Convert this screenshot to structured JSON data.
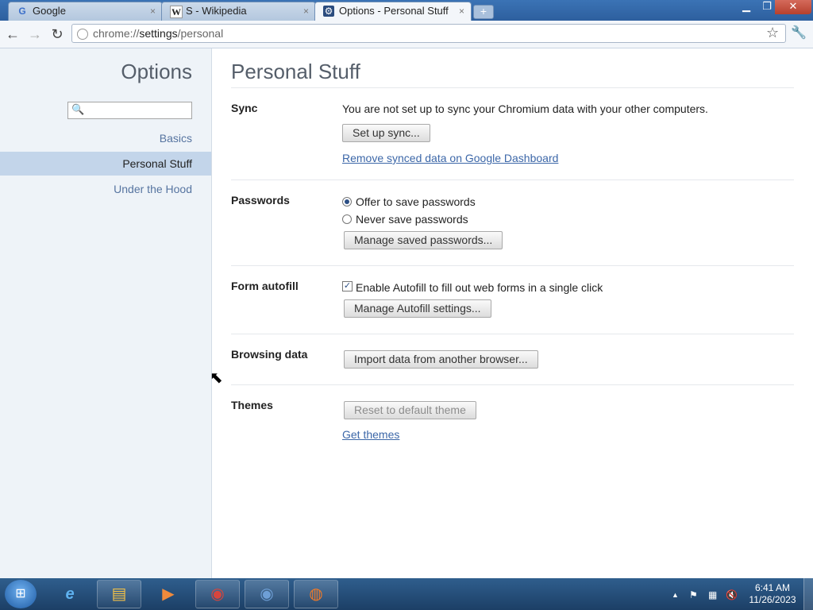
{
  "tabs": [
    {
      "favicon": "G",
      "title": "Google",
      "close": "×"
    },
    {
      "favicon": "W",
      "title": "S - Wikipedia",
      "close": "×"
    },
    {
      "favicon": "⚙",
      "title": "Options - Personal Stuff",
      "close": "×"
    }
  ],
  "new_tab_label": "+",
  "window_controls": {
    "minimize": "▁",
    "maximize": "❐",
    "close": "✕"
  },
  "toolbar": {
    "back": "←",
    "forward": "→",
    "reload": "↻",
    "url_prefix": "chrome://",
    "url_host": "settings",
    "url_path": "/personal",
    "star": "☆",
    "wrench": "🔧"
  },
  "sidebar": {
    "title": "Options",
    "search_icon": "🔍",
    "search_placeholder": "",
    "items": [
      {
        "label": "Basics"
      },
      {
        "label": "Personal Stuff"
      },
      {
        "label": "Under the Hood"
      }
    ]
  },
  "page": {
    "title": "Personal Stuff",
    "sync": {
      "label": "Sync",
      "status": "You are not set up to sync your Chromium data with your other computers.",
      "setup_button": "Set up sync...",
      "dashboard_link": "Remove synced data on Google Dashboard"
    },
    "passwords": {
      "label": "Passwords",
      "offer": "Offer to save passwords",
      "never": "Never save passwords",
      "selected": "offer",
      "manage_button": "Manage saved passwords..."
    },
    "autofill": {
      "label": "Form autofill",
      "checkbox_label": "Enable Autofill to fill out web forms in a single click",
      "checked": true,
      "check_glyph": "✓",
      "manage_button": "Manage Autofill settings..."
    },
    "browsing": {
      "label": "Browsing data",
      "import_button": "Import data from another browser..."
    },
    "themes": {
      "label": "Themes",
      "reset_button": "Reset to default theme",
      "get_link": "Get themes"
    }
  },
  "cursor_glyph": "⬉",
  "taskbar": {
    "start_glyph": "⊞",
    "apps": [
      {
        "name": "internet-explorer",
        "glyph": "e",
        "color": "#5fb2f0"
      },
      {
        "name": "file-explorer",
        "glyph": "▤",
        "color": "#f0c048"
      },
      {
        "name": "media-player",
        "glyph": "▶",
        "color": "#f08a3c"
      },
      {
        "name": "chrome",
        "glyph": "◉",
        "color": "#d6453d"
      },
      {
        "name": "chromium",
        "glyph": "◉",
        "color": "#6e9fd6"
      },
      {
        "name": "firefox",
        "glyph": "◍",
        "color": "#f07a28"
      }
    ],
    "tray_arrow": "▲",
    "tray_flag": "⚑",
    "tray_network": "▦",
    "tray_volume": "🔇",
    "time": "6:41 AM",
    "date": "11/26/2023"
  }
}
